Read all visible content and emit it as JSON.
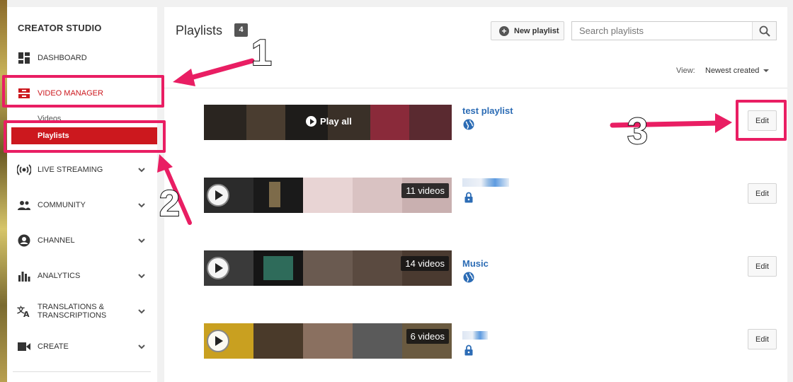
{
  "sidebar": {
    "title": "CREATOR STUDIO",
    "items": [
      {
        "label": "DASHBOARD",
        "icon": "dashboard-icon"
      },
      {
        "label": "VIDEO MANAGER",
        "icon": "video-manager-icon",
        "active": true
      },
      {
        "label": "LIVE STREAMING",
        "icon": "live-streaming-icon"
      },
      {
        "label": "COMMUNITY",
        "icon": "community-icon"
      },
      {
        "label": "CHANNEL",
        "icon": "channel-icon"
      },
      {
        "label": "ANALYTICS",
        "icon": "analytics-icon"
      },
      {
        "label": "TRANSLATIONS & TRANSCRIPTIONS",
        "label_line1": "TRANSLATIONS &",
        "label_line2": "TRANSCRIPTIONS",
        "icon": "translate-icon"
      },
      {
        "label": "CREATE",
        "icon": "create-icon"
      }
    ],
    "sub_items": [
      {
        "label": "Videos"
      },
      {
        "label": "Playlists",
        "selected": true
      }
    ]
  },
  "header": {
    "title": "Playlists",
    "count": "4",
    "new_playlist_label": "New playlist",
    "search_placeholder": "Search playlists",
    "view_label": "View:",
    "view_value": "Newest created"
  },
  "playlists": [
    {
      "name": "test playlist",
      "privacy": "public",
      "overlay": "Play all",
      "edit_label": "Edit"
    },
    {
      "name": "",
      "privacy": "private",
      "overlay": "11 videos",
      "edit_label": "Edit"
    },
    {
      "name": "Music",
      "privacy": "public",
      "overlay": "14 videos",
      "edit_label": "Edit"
    },
    {
      "name": "",
      "privacy": "private",
      "overlay": "6 videos",
      "edit_label": "Edit"
    }
  ],
  "annotations": {
    "step1": "1",
    "step2": "2",
    "step3": "3",
    "color": "#e91e63"
  },
  "colors": {
    "accent_red": "#cc181e",
    "link_blue": "#2c6cb5"
  }
}
